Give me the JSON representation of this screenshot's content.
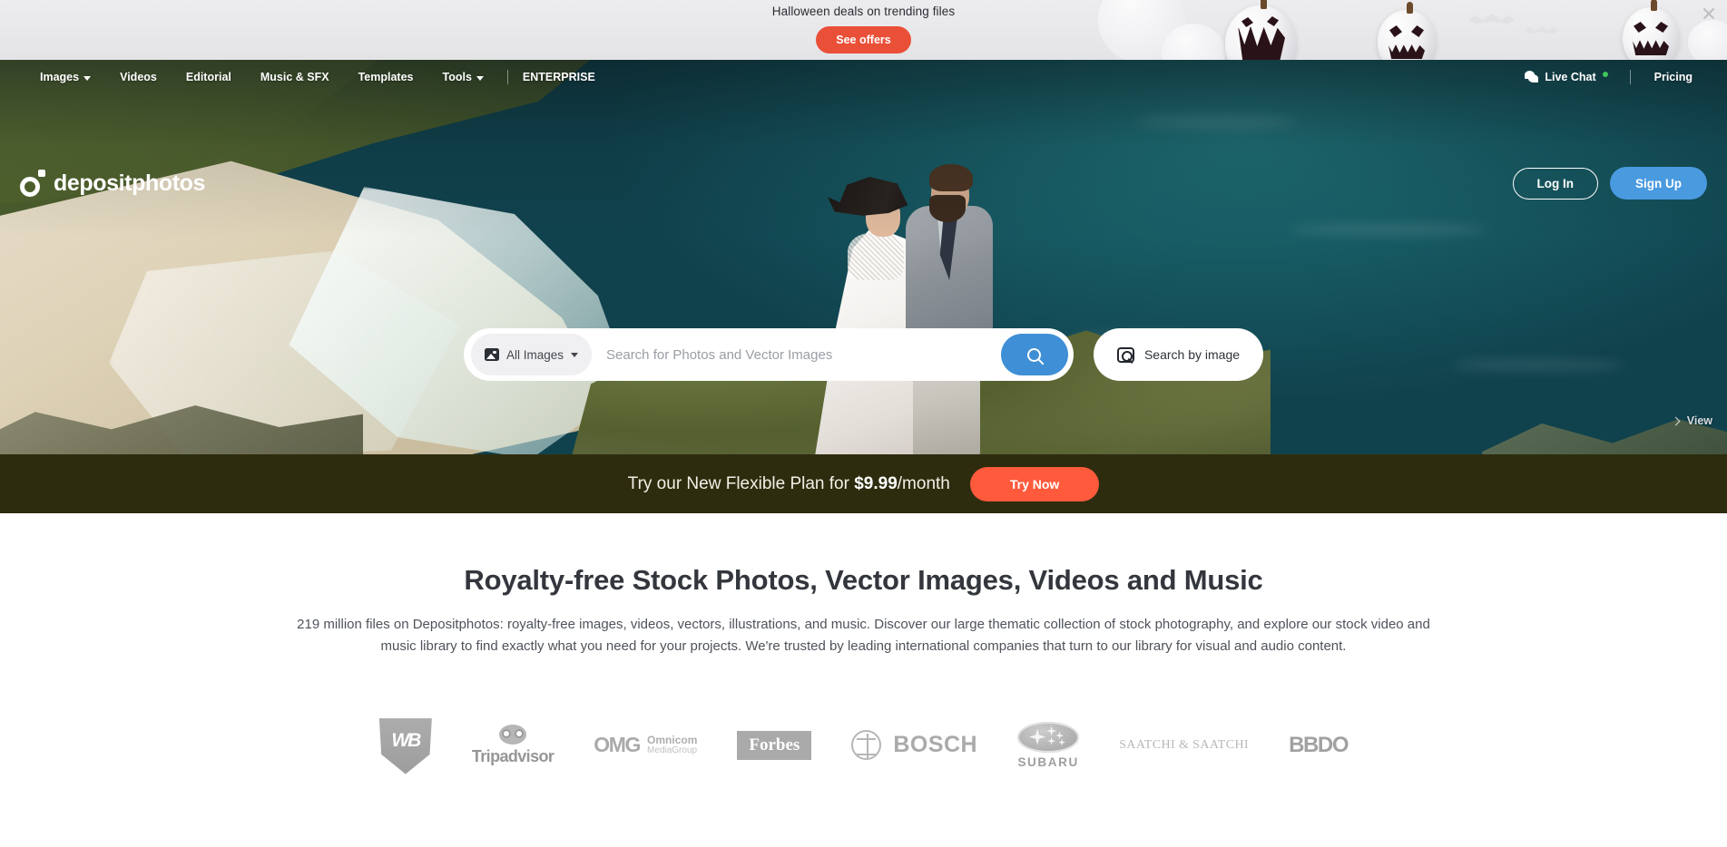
{
  "promo": {
    "text": "Halloween deals on trending files",
    "button": "See offers",
    "close_icon": "close-icon",
    "accent": "#ea4f38"
  },
  "nav": {
    "items": [
      {
        "label": "Images",
        "has_caret": true
      },
      {
        "label": "Videos",
        "has_caret": false
      },
      {
        "label": "Editorial",
        "has_caret": false
      },
      {
        "label": "Music & SFX",
        "has_caret": false
      },
      {
        "label": "Templates",
        "has_caret": false
      },
      {
        "label": "Tools",
        "has_caret": true
      },
      {
        "label": "ENTERPRISE",
        "has_caret": false
      }
    ],
    "live_chat": "Live Chat",
    "pricing": "Pricing",
    "status_color": "#3fc45c"
  },
  "brand": {
    "name": "depositphotos"
  },
  "auth": {
    "login": "Log In",
    "signup": "Sign Up",
    "signup_color": "#4a9ae0"
  },
  "search": {
    "category": "All Images",
    "placeholder": "Search for Photos and Vector Images",
    "value": "",
    "search_icon": "search-icon",
    "by_image": "Search by image",
    "button_color": "#3f8fd6"
  },
  "hero": {
    "view_label": "View"
  },
  "plan": {
    "text_before": "Try our New Flexible Plan for ",
    "price": "$9.99",
    "text_after": "/month",
    "button": "Try Now",
    "button_color": "#ff5a3c",
    "background": "#2e2c0e"
  },
  "main": {
    "heading": "Royalty-free Stock Photos, Vector Images, Videos and Music",
    "paragraph": "219 million files on Depositphotos: royalty-free images, videos, vectors, illustrations, and music. Discover our large thematic collection of stock photography, and explore our stock video and music library to find exactly what you need for your projects. We're trusted by leading international companies that turn to our library for visual and audio content."
  },
  "brands": [
    {
      "name": "Warner Bros",
      "mark": "WB"
    },
    {
      "name": "Tripadvisor",
      "label": "Tripadvisor"
    },
    {
      "name": "OMG Omnicom MediaGroup",
      "mark": "OMG",
      "line1": "Omnicom",
      "line2": "MediaGroup"
    },
    {
      "name": "Forbes",
      "label": "Forbes"
    },
    {
      "name": "Bosch",
      "label": "BOSCH"
    },
    {
      "name": "Subaru",
      "label": "SUBARU"
    },
    {
      "name": "Saatchi & Saatchi",
      "label": "SAATCHI & SAATCHI"
    },
    {
      "name": "BBDO",
      "label": "BBDO"
    }
  ]
}
